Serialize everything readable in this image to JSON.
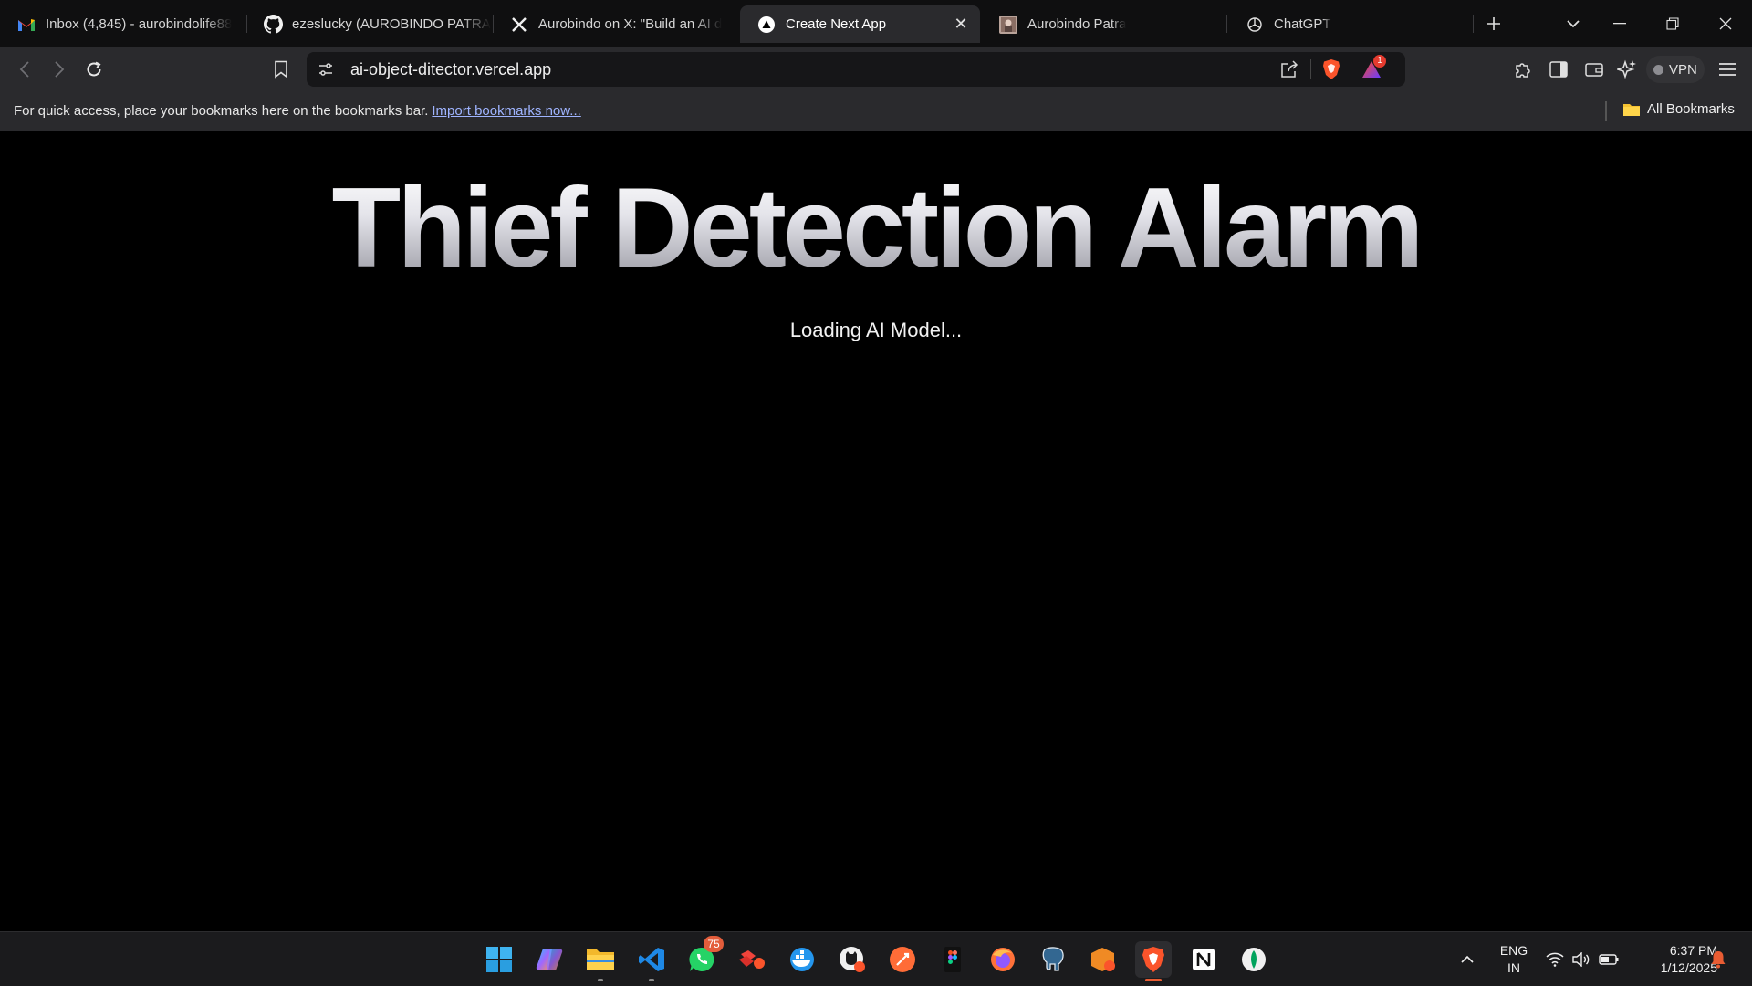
{
  "tabs": [
    {
      "title": "Inbox (4,845) - aurobindolife88",
      "icon": "gmail-icon"
    },
    {
      "title": "ezeslucky (AUROBINDO PATRA)",
      "icon": "github-icon"
    },
    {
      "title": "Aurobindo on X: \"Build an AI d",
      "icon": "x-icon"
    },
    {
      "title": "Create Next App",
      "icon": "vercel-icon"
    },
    {
      "title": "Aurobindo Patra",
      "icon": "profile-photo-icon"
    },
    {
      "title": "ChatGPT",
      "icon": "chatgpt-icon"
    }
  ],
  "toolbar": {
    "url": "ai-object-ditector.vercel.app",
    "vpn_label": "VPN",
    "rewards_badge": "1"
  },
  "bookmarks_bar": {
    "message": "For quick access, place your bookmarks here on the bookmarks bar.",
    "import_link": "Import bookmarks now...",
    "all_bookmarks": "All Bookmarks"
  },
  "page": {
    "heading": "Thief Detection Alarm",
    "status": "Loading AI Model..."
  },
  "taskbar": {
    "apps": [
      "windows-start",
      "copilot",
      "file-explorer",
      "vscode",
      "whatsapp",
      "anydesk",
      "docker",
      "github-desktop",
      "postman",
      "figma",
      "firefox",
      "postgresql",
      "brave-nightly",
      "brave",
      "notion",
      "mongodb-compass"
    ],
    "whatsapp_badge": "75",
    "language_line1": "ENG",
    "language_line2": "IN",
    "time": "6:37 PM",
    "date": "1/12/2025"
  },
  "colors": {
    "accent": "#e85c33",
    "link": "#9fb4ff",
    "page_bg": "#000000",
    "chrome_bg": "#2a2a2d"
  }
}
